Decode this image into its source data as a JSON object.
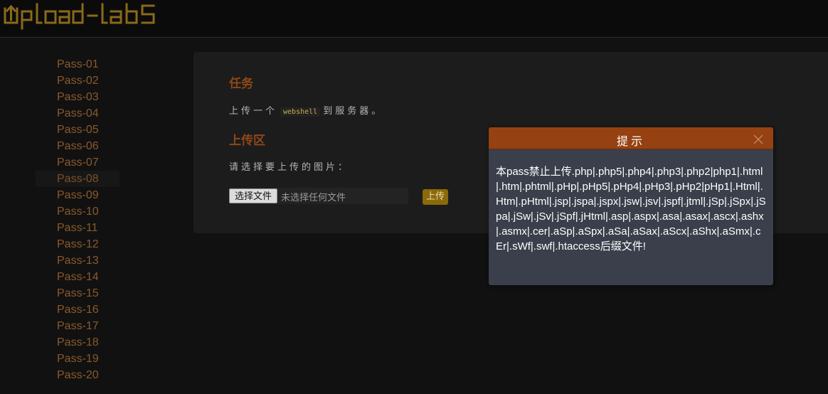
{
  "header": {
    "logo_text": "Upload-labs",
    "logo_icon": "upload-arrow-icon"
  },
  "sidebar": {
    "items": [
      {
        "label": "Pass-01"
      },
      {
        "label": "Pass-02"
      },
      {
        "label": "Pass-03"
      },
      {
        "label": "Pass-04"
      },
      {
        "label": "Pass-05"
      },
      {
        "label": "Pass-06"
      },
      {
        "label": "Pass-07"
      },
      {
        "label": "Pass-08"
      },
      {
        "label": "Pass-09"
      },
      {
        "label": "Pass-10"
      },
      {
        "label": "Pass-11"
      },
      {
        "label": "Pass-12"
      },
      {
        "label": "Pass-13"
      },
      {
        "label": "Pass-14"
      },
      {
        "label": "Pass-15"
      },
      {
        "label": "Pass-16"
      },
      {
        "label": "Pass-17"
      },
      {
        "label": "Pass-18"
      },
      {
        "label": "Pass-19"
      },
      {
        "label": "Pass-20"
      }
    ],
    "active": "Pass-08"
  },
  "main": {
    "task_heading": "任务",
    "task_prefix": "上传一个",
    "task_code": "webshell",
    "task_suffix": "到服务器。",
    "upload_heading": "上传区",
    "upload_prompt": "请选择要上传的图片：",
    "file_button_label": "选择文件",
    "file_status": "未选择任何文件",
    "upload_button_label": "上传"
  },
  "dialog": {
    "title": "提示",
    "message": "本pass禁止上传.php|.php5|.php4|.php3|.php2|php1|.html|.htm|.phtml|.pHp|.pHp5|.pHp4|.pHp3|.pHp2|pHp1|.Html|.Htm|.pHtml|.jsp|.jspa|.jspx|.jsw|.jsv|.jspf|.jtml|.jSp|.jSpx|.jSpa|.jSw|.jSv|.jSpf|.jHtml|.asp|.aspx|.asa|.asax|.ascx|.ashx|.asmx|.cer|.aSp|.aSpx|.aSa|.aSax|.aScx|.aShx|.aSmx|.cEr|.sWf|.swf|.htaccess后缀文件!",
    "close_icon": "close-icon"
  },
  "colors": {
    "accent": "#964111",
    "sidebar_link": "#8a5a2b",
    "upload_button": "#8a6a0a",
    "dialog_bg": "#3a3f4b"
  }
}
